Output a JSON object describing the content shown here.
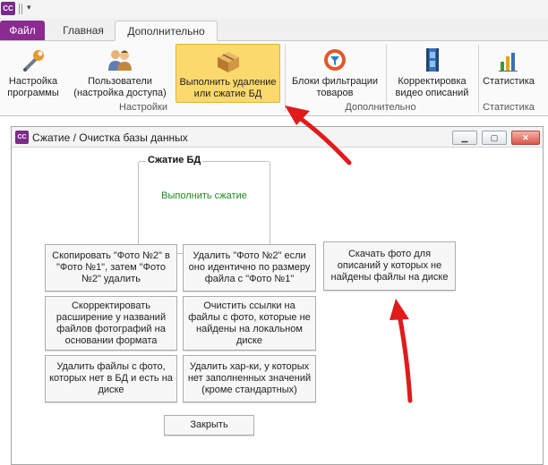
{
  "qat": {
    "logo_text": "CC"
  },
  "tabs": {
    "file": "Файл",
    "main": "Главная",
    "extra": "Дополнительно"
  },
  "ribbon": {
    "groups": [
      {
        "label": "Настройки"
      },
      {
        "label": "Дополнительно"
      },
      {
        "label": "Статистика"
      }
    ],
    "buttons": [
      {
        "label": "Настройка\nпрограммы",
        "icon": "wrench-icon"
      },
      {
        "label": "Пользователи\n(настройка доступа)",
        "icon": "users-icon"
      },
      {
        "label": "Выполнить удаление\nили сжатие БД",
        "icon": "box-icon",
        "active": true
      },
      {
        "label": "Блоки фильтрации\nтоваров",
        "icon": "filter-icon"
      },
      {
        "label": "Корректировка\nвидео описаний",
        "icon": "film-icon"
      },
      {
        "label": "Статистика",
        "icon": "bar-chart-icon"
      }
    ]
  },
  "window": {
    "title": "Сжатие / Очистка базы данных",
    "icon_text": "CC",
    "group_box": {
      "title": "Сжатие БД",
      "action": "Выполнить сжатие"
    },
    "buttons": [
      "Скопировать \"Фото №2\" в \"Фото №1\", затем \"Фото №2\" удалить",
      "Удалить \"Фото №2\" если оно идентично по размеру файла с \"Фото №1\"",
      "Скачать фото для описаний у которых не найдены файлы на диске",
      "Скорректировать расширение у названий файлов фотографий на основании формата",
      "Очистить ссылки на файлы с фото, которые не найдены на локальном диске",
      "Удалить файлы с фото, которых нет в БД и есть на диске",
      "Удалить хар-ки, у которых нет заполненных значений (кроме стандартных)"
    ],
    "close_button": "Закрыть"
  },
  "colors": {
    "file_tab": "#8b2a91",
    "active_button": "#fcd96d",
    "action_text": "#1d8a1d",
    "annotation_arrow": "#e01b1b"
  }
}
